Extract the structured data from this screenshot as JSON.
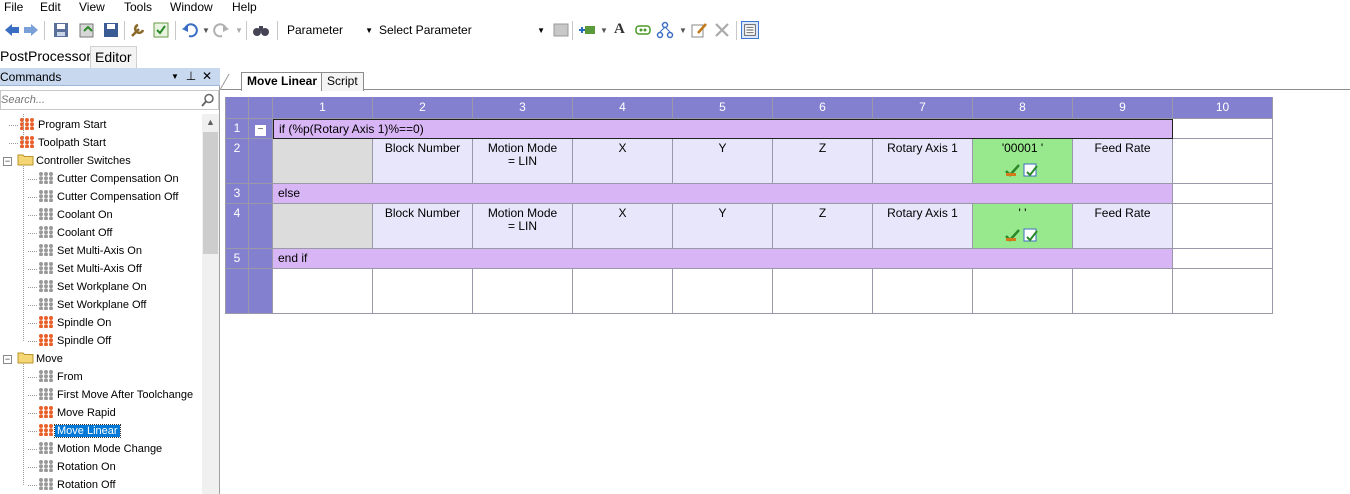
{
  "menu": [
    "File",
    "Edit",
    "View",
    "Tools",
    "Window",
    "Help"
  ],
  "toolbar": {
    "parameter_combo": "Parameter",
    "select_parameter_combo": "Select Parameter"
  },
  "doc_tabs": [
    "PostProcessor",
    "Editor"
  ],
  "commands_panel": {
    "title": "Commands",
    "search_placeholder": "Search...",
    "tree": [
      {
        "label": "Program Start",
        "level": 1,
        "icon": "command-red-icon"
      },
      {
        "label": "Toolpath Start",
        "level": 1,
        "icon": "command-red-icon"
      },
      {
        "label": "Controller Switches",
        "level": 0,
        "icon": "folder-icon"
      },
      {
        "label": "Cutter Compensation On",
        "level": 2,
        "icon": "command-gray-icon"
      },
      {
        "label": "Cutter Compensation Off",
        "level": 2,
        "icon": "command-gray-icon"
      },
      {
        "label": "Coolant On",
        "level": 2,
        "icon": "command-gray-icon"
      },
      {
        "label": "Coolant Off",
        "level": 2,
        "icon": "command-gray-icon"
      },
      {
        "label": "Set Multi-Axis On",
        "level": 2,
        "icon": "command-gray-icon"
      },
      {
        "label": "Set Multi-Axis Off",
        "level": 2,
        "icon": "command-gray-icon"
      },
      {
        "label": "Set Workplane On",
        "level": 2,
        "icon": "command-gray-icon"
      },
      {
        "label": "Set Workplane Off",
        "level": 2,
        "icon": "command-gray-icon"
      },
      {
        "label": "Spindle On",
        "level": 2,
        "icon": "command-red-icon"
      },
      {
        "label": "Spindle Off",
        "level": 2,
        "icon": "command-red-icon"
      },
      {
        "label": "Move",
        "level": 0,
        "icon": "folder-icon"
      },
      {
        "label": "From",
        "level": 2,
        "icon": "command-gray-icon"
      },
      {
        "label": "First Move After Toolchange",
        "level": 2,
        "icon": "command-gray-icon"
      },
      {
        "label": "Move Rapid",
        "level": 2,
        "icon": "command-red-icon"
      },
      {
        "label": "Move Linear",
        "level": 2,
        "icon": "command-red-icon",
        "selected": true
      },
      {
        "label": "Motion Mode Change",
        "level": 2,
        "icon": "command-gray-icon"
      },
      {
        "label": "Rotation On",
        "level": 2,
        "icon": "command-gray-icon"
      },
      {
        "label": "Rotation Off",
        "level": 2,
        "icon": "command-gray-icon"
      }
    ]
  },
  "editor_tabs": [
    "Move Linear",
    "Script"
  ],
  "grid": {
    "columns": [
      "1",
      "2",
      "3",
      "4",
      "5",
      "6",
      "7",
      "8",
      "9",
      "10"
    ],
    "rows": {
      "r1": {
        "num": "1",
        "text": "if  (%p(Rotary Axis 1)%==0)"
      },
      "r2": {
        "num": "2",
        "cells": [
          "Block Number",
          "Motion Mode = LIN",
          "X",
          "Y",
          "Z",
          "Rotary Axis 1",
          "'00001 '",
          "Feed Rate"
        ]
      },
      "r3": {
        "num": "3",
        "text": "else"
      },
      "r4": {
        "num": "4",
        "cells": [
          "Block Number",
          "Motion Mode = LIN",
          "X",
          "Y",
          "Z",
          "Rotary Axis 1",
          "' '",
          "Feed Rate"
        ]
      },
      "r5": {
        "num": "5",
        "text": "end if"
      }
    }
  },
  "colors": {
    "header_purple": "#8480d0",
    "condition_row": "#d8b6f5",
    "lavender_cell": "#e8e6fb",
    "green_cell": "#98e98e",
    "selection_blue": "#0078d7"
  }
}
